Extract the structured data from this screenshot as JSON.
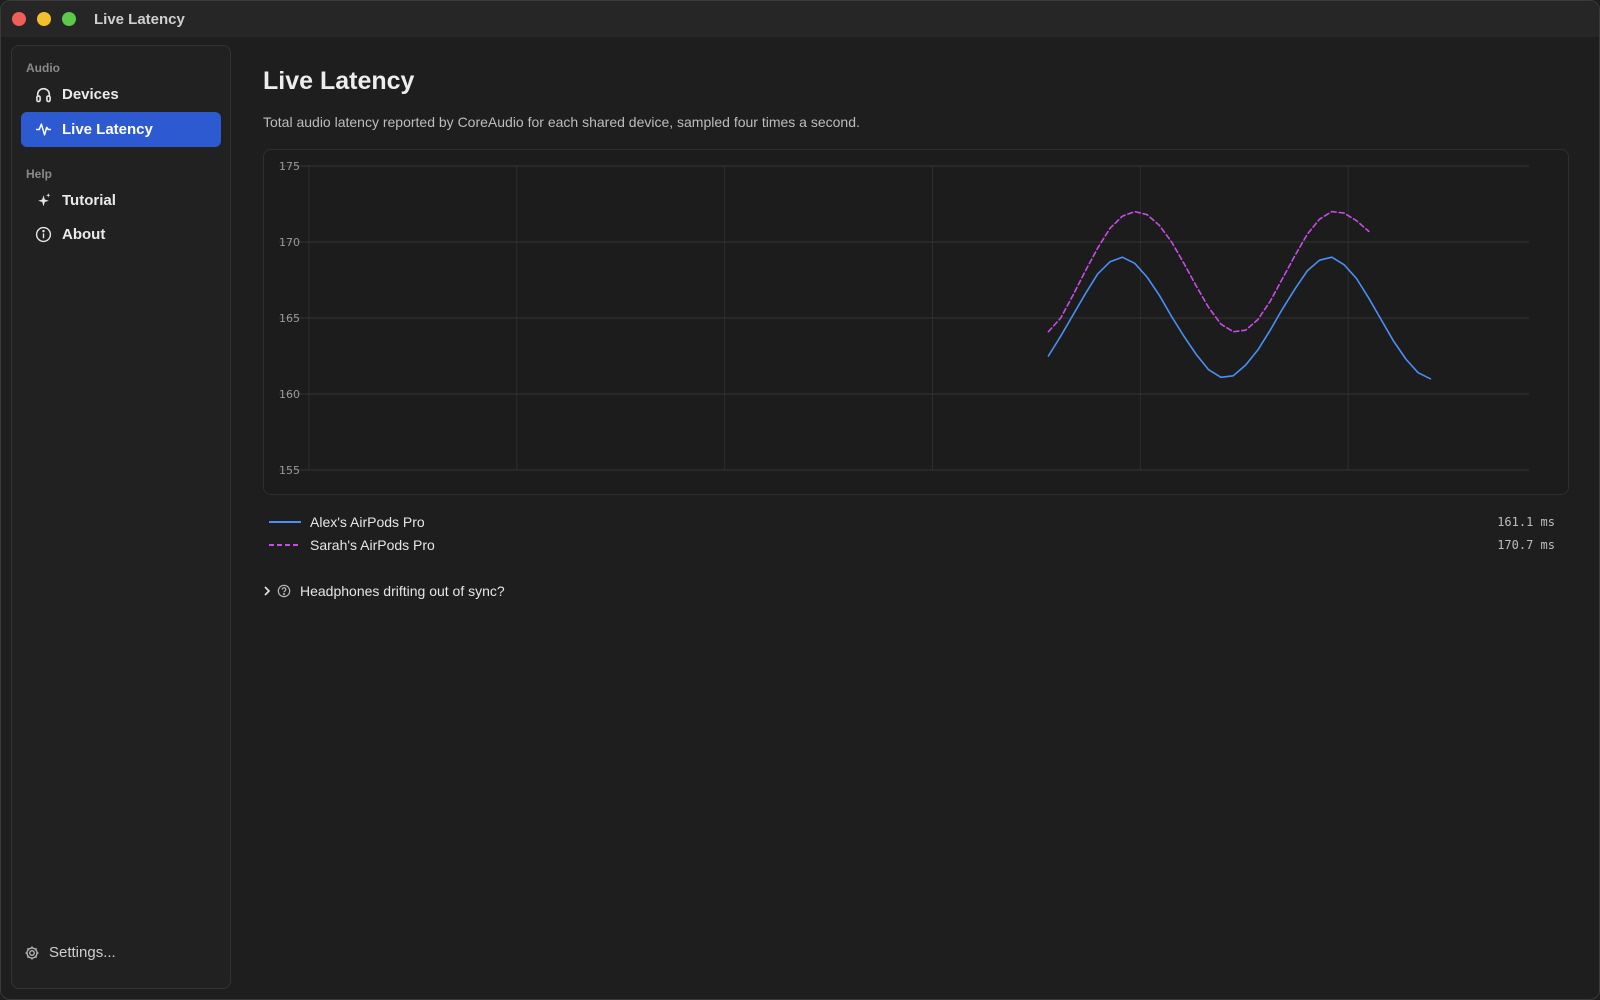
{
  "window": {
    "title": "Live Latency"
  },
  "sidebar": {
    "sections": [
      {
        "label": "Audio",
        "items": [
          {
            "label": "Devices",
            "icon": "headphones-icon",
            "active": false
          },
          {
            "label": "Live Latency",
            "icon": "waveform-icon",
            "active": true
          }
        ]
      },
      {
        "label": "Help",
        "items": [
          {
            "label": "Tutorial",
            "icon": "sparkles-icon",
            "active": false
          },
          {
            "label": "About",
            "icon": "info-icon",
            "active": false
          }
        ]
      }
    ],
    "settings_label": "Settings..."
  },
  "main": {
    "title": "Live Latency",
    "description": "Total audio latency reported by CoreAudio for each shared device, sampled four times a second.",
    "disclosure_label": "Headphones drifting out of sync?"
  },
  "legend": [
    {
      "name": "Alex's AirPods Pro",
      "value": "161.1 ms",
      "color": "#4a8ff5",
      "dashed": false
    },
    {
      "name": "Sarah's AirPods Pro",
      "value": "170.7 ms",
      "color": "#c74de8",
      "dashed": true
    }
  ],
  "chart_data": {
    "type": "line",
    "ylim": [
      155,
      175
    ],
    "yticks": [
      "175",
      "170",
      "165",
      "160",
      "155"
    ],
    "grid": true,
    "legend": "bottom-left",
    "x": [
      0,
      1,
      2,
      3,
      4,
      5,
      6,
      7,
      8,
      9,
      10,
      11,
      12,
      13,
      14,
      15,
      16,
      17,
      18,
      19,
      20,
      21,
      22,
      23,
      24,
      25,
      26,
      27,
      28,
      29,
      30,
      31,
      32,
      33,
      34,
      35,
      36,
      37,
      38,
      39,
      40,
      41,
      42,
      43,
      44,
      45,
      46,
      47,
      48,
      49,
      50,
      51,
      52,
      53,
      54,
      55,
      56,
      57,
      58,
      59,
      60,
      61,
      62,
      63,
      64,
      65,
      66,
      67,
      68,
      69,
      70,
      71,
      72,
      73,
      74,
      75,
      76,
      77,
      78,
      79,
      80,
      81,
      82,
      83,
      84,
      85,
      86,
      87,
      88,
      89,
      90,
      91,
      92,
      93,
      94,
      95,
      96,
      97,
      98,
      99
    ],
    "series": [
      {
        "name": "Alex's AirPods Pro",
        "color": "#4a8ff5",
        "dashed": false,
        "values": [
          null,
          null,
          null,
          null,
          null,
          null,
          null,
          null,
          null,
          null,
          null,
          null,
          null,
          null,
          null,
          null,
          null,
          null,
          null,
          null,
          null,
          null,
          null,
          null,
          null,
          null,
          null,
          null,
          null,
          null,
          null,
          null,
          null,
          null,
          null,
          null,
          null,
          null,
          null,
          null,
          null,
          null,
          null,
          null,
          null,
          null,
          null,
          null,
          null,
          null,
          null,
          null,
          null,
          null,
          null,
          null,
          null,
          null,
          null,
          null,
          162.5,
          163.8,
          165.2,
          166.6,
          167.9,
          168.7,
          169.0,
          168.6,
          167.7,
          166.5,
          165.1,
          163.8,
          162.6,
          161.6,
          161.1,
          161.2,
          161.9,
          162.9,
          164.2,
          165.6,
          166.9,
          168.1,
          168.8,
          169.0,
          168.5,
          167.6,
          166.3,
          164.9,
          163.5,
          162.3,
          161.4,
          161.0,
          null,
          null,
          null,
          null,
          null,
          null,
          null,
          null
        ]
      },
      {
        "name": "Sarah's AirPods Pro",
        "color": "#c74de8",
        "dashed": true,
        "values": [
          null,
          null,
          null,
          null,
          null,
          null,
          null,
          null,
          null,
          null,
          null,
          null,
          null,
          null,
          null,
          null,
          null,
          null,
          null,
          null,
          null,
          null,
          null,
          null,
          null,
          null,
          null,
          null,
          null,
          null,
          null,
          null,
          null,
          null,
          null,
          null,
          null,
          null,
          null,
          null,
          null,
          null,
          null,
          null,
          null,
          null,
          null,
          null,
          null,
          null,
          null,
          null,
          null,
          null,
          null,
          null,
          null,
          null,
          null,
          null,
          164.1,
          165.0,
          166.5,
          168.1,
          169.6,
          170.9,
          171.7,
          172.0,
          171.8,
          171.1,
          170.0,
          168.6,
          167.1,
          165.7,
          164.6,
          164.1,
          164.2,
          164.9,
          166.1,
          167.6,
          169.1,
          170.5,
          171.5,
          172.0,
          171.9,
          171.4,
          170.7,
          null,
          null,
          null,
          null,
          null,
          null,
          null,
          null,
          null,
          null,
          null,
          null,
          null
        ]
      }
    ]
  }
}
